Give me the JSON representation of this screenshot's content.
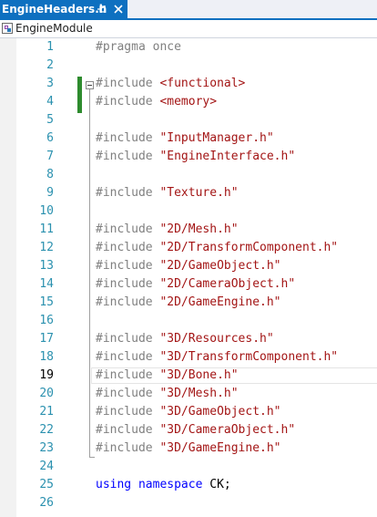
{
  "tab": {
    "title": "EngineHeaders.h",
    "pin_icon": "pin-icon",
    "close_icon": "close-icon"
  },
  "navbar": {
    "icon": "module-icon",
    "label": "EngineModule"
  },
  "editor": {
    "current_line": 19,
    "lines": [
      {
        "n": "1",
        "tokens": [
          {
            "t": "#pragma once",
            "c": "kw-pp"
          }
        ]
      },
      {
        "n": "2",
        "tokens": []
      },
      {
        "n": "3",
        "tokens": [
          {
            "t": "#include ",
            "c": "kw-pp"
          },
          {
            "t": "<functional>",
            "c": "str"
          }
        ]
      },
      {
        "n": "4",
        "tokens": [
          {
            "t": "#include ",
            "c": "kw-pp"
          },
          {
            "t": "<memory>",
            "c": "str"
          }
        ]
      },
      {
        "n": "5",
        "tokens": []
      },
      {
        "n": "6",
        "tokens": [
          {
            "t": "#include ",
            "c": "kw-pp"
          },
          {
            "t": "\"InputManager.h\"",
            "c": "str"
          }
        ]
      },
      {
        "n": "7",
        "tokens": [
          {
            "t": "#include ",
            "c": "kw-pp"
          },
          {
            "t": "\"EngineInterface.h\"",
            "c": "str"
          }
        ]
      },
      {
        "n": "8",
        "tokens": []
      },
      {
        "n": "9",
        "tokens": [
          {
            "t": "#include ",
            "c": "kw-pp"
          },
          {
            "t": "\"Texture.h\"",
            "c": "str"
          }
        ]
      },
      {
        "n": "10",
        "tokens": []
      },
      {
        "n": "11",
        "tokens": [
          {
            "t": "#include ",
            "c": "kw-pp"
          },
          {
            "t": "\"2D/Mesh.h\"",
            "c": "str"
          }
        ]
      },
      {
        "n": "12",
        "tokens": [
          {
            "t": "#include ",
            "c": "kw-pp"
          },
          {
            "t": "\"2D/TransformComponent.h\"",
            "c": "str"
          }
        ]
      },
      {
        "n": "13",
        "tokens": [
          {
            "t": "#include ",
            "c": "kw-pp"
          },
          {
            "t": "\"2D/GameObject.h\"",
            "c": "str"
          }
        ]
      },
      {
        "n": "14",
        "tokens": [
          {
            "t": "#include ",
            "c": "kw-pp"
          },
          {
            "t": "\"2D/CameraObject.h\"",
            "c": "str"
          }
        ]
      },
      {
        "n": "15",
        "tokens": [
          {
            "t": "#include ",
            "c": "kw-pp"
          },
          {
            "t": "\"2D/GameEngine.h\"",
            "c": "str"
          }
        ]
      },
      {
        "n": "16",
        "tokens": []
      },
      {
        "n": "17",
        "tokens": [
          {
            "t": "#include ",
            "c": "kw-pp"
          },
          {
            "t": "\"3D/Resources.h\"",
            "c": "str"
          }
        ]
      },
      {
        "n": "18",
        "tokens": [
          {
            "t": "#include ",
            "c": "kw-pp"
          },
          {
            "t": "\"3D/TransformComponent.h\"",
            "c": "str"
          }
        ]
      },
      {
        "n": "19",
        "tokens": [
          {
            "t": "#include ",
            "c": "kw-pp"
          },
          {
            "t": "\"3D/Bone.h\"",
            "c": "str"
          }
        ]
      },
      {
        "n": "20",
        "tokens": [
          {
            "t": "#include ",
            "c": "kw-pp"
          },
          {
            "t": "\"3D/Mesh.h\"",
            "c": "str"
          }
        ]
      },
      {
        "n": "21",
        "tokens": [
          {
            "t": "#include ",
            "c": "kw-pp"
          },
          {
            "t": "\"3D/GameObject.h\"",
            "c": "str"
          }
        ]
      },
      {
        "n": "22",
        "tokens": [
          {
            "t": "#include ",
            "c": "kw-pp"
          },
          {
            "t": "\"3D/CameraObject.h\"",
            "c": "str"
          }
        ]
      },
      {
        "n": "23",
        "tokens": [
          {
            "t": "#include ",
            "c": "kw-pp"
          },
          {
            "t": "\"3D/GameEngine.h\"",
            "c": "str"
          }
        ]
      },
      {
        "n": "24",
        "tokens": []
      },
      {
        "n": "25",
        "tokens": [
          {
            "t": "using",
            "c": "kw-blue"
          },
          {
            "t": " ",
            "c": "ns"
          },
          {
            "t": "namespace",
            "c": "kw-blue"
          },
          {
            "t": " CK;",
            "c": "ns"
          }
        ]
      },
      {
        "n": "26",
        "tokens": []
      }
    ]
  },
  "colors": {
    "tab_active": "#0e70c0",
    "line_number": "#2b91af",
    "preprocessor": "#808080",
    "string": "#a31515",
    "keyword": "#0000ff",
    "change_bar": "#2e8b2e"
  }
}
